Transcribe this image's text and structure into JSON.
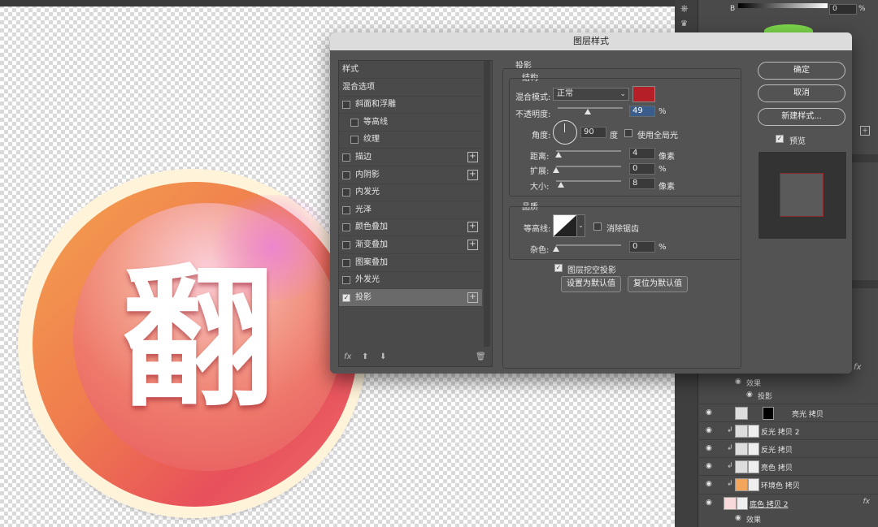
{
  "canvas": {
    "badge_character": "翻"
  },
  "right_panel": {
    "b_label": "B",
    "b_value": "0",
    "b_unit": "%",
    "layers": [
      {
        "name": "效果",
        "type": "sub"
      },
      {
        "name": "投影",
        "type": "sub2"
      },
      {
        "name": "亮光 拷贝",
        "type": "layer",
        "fx": ""
      },
      {
        "name": "反光 拷贝 2",
        "type": "layer",
        "fx": ""
      },
      {
        "name": "反光 拷贝",
        "type": "layer",
        "fx": ""
      },
      {
        "name": "亮色 拷贝",
        "type": "layer",
        "fx": ""
      },
      {
        "name": "环境色 拷贝",
        "type": "layer",
        "fx": ""
      },
      {
        "name": "底色 拷贝 2",
        "type": "layer",
        "fx": "fx"
      },
      {
        "name": "效果",
        "type": "sub"
      }
    ],
    "fx_top": "fx"
  },
  "dialog": {
    "title": "图层样式",
    "styles": [
      {
        "label": "样式",
        "checkbox": false,
        "checked": false,
        "plus": false,
        "indent": 0
      },
      {
        "label": "混合选项",
        "checkbox": false,
        "checked": false,
        "plus": false,
        "indent": 0
      },
      {
        "label": "斜面和浮雕",
        "checkbox": true,
        "checked": false,
        "plus": false,
        "indent": 0
      },
      {
        "label": "等高线",
        "checkbox": true,
        "checked": false,
        "plus": false,
        "indent": 1
      },
      {
        "label": "纹理",
        "checkbox": true,
        "checked": false,
        "plus": false,
        "indent": 1
      },
      {
        "label": "描边",
        "checkbox": true,
        "checked": false,
        "plus": true,
        "indent": 0
      },
      {
        "label": "内阴影",
        "checkbox": true,
        "checked": false,
        "plus": true,
        "indent": 0
      },
      {
        "label": "内发光",
        "checkbox": true,
        "checked": false,
        "plus": false,
        "indent": 0
      },
      {
        "label": "光泽",
        "checkbox": true,
        "checked": false,
        "plus": false,
        "indent": 0
      },
      {
        "label": "颜色叠加",
        "checkbox": true,
        "checked": false,
        "plus": true,
        "indent": 0
      },
      {
        "label": "渐变叠加",
        "checkbox": true,
        "checked": false,
        "plus": true,
        "indent": 0
      },
      {
        "label": "图案叠加",
        "checkbox": true,
        "checked": false,
        "plus": false,
        "indent": 0
      },
      {
        "label": "外发光",
        "checkbox": true,
        "checked": false,
        "plus": false,
        "indent": 0
      },
      {
        "label": "投影",
        "checkbox": true,
        "checked": true,
        "plus": true,
        "indent": 0,
        "selected": true
      }
    ],
    "footer": {
      "fx": "fx",
      "up": "⬆",
      "down": "⬇",
      "trash": "🗑"
    },
    "drop_shadow": {
      "section_title": "投影",
      "structure_title": "结构",
      "blend_mode_label": "混合模式:",
      "blend_mode_value": "正常",
      "shadow_color": "#b52028",
      "opacity_label": "不透明度:",
      "opacity_value": "49",
      "angle_label": "角度:",
      "angle_value": "90",
      "angle_unit": "度",
      "global_light_label": "使用全局光",
      "global_light_checked": false,
      "distance_label": "距离:",
      "distance_value": "4",
      "distance_unit": "像素",
      "spread_label": "扩展:",
      "spread_value": "0",
      "size_label": "大小:",
      "size_value": "8",
      "size_unit": "像素",
      "percent_unit": "%",
      "quality_title": "品质",
      "contour_label": "等高线:",
      "antialias_label": "消除锯齿",
      "antialias_checked": false,
      "noise_label": "杂色:",
      "noise_value": "0",
      "knockout_label": "图层挖空投影",
      "knockout_checked": true,
      "set_default_label": "设置为默认值",
      "reset_default_label": "复位为默认值"
    },
    "buttons": {
      "ok": "确定",
      "cancel": "取消",
      "new_style": "新建样式...",
      "preview_label": "预览",
      "preview_checked": true
    }
  }
}
